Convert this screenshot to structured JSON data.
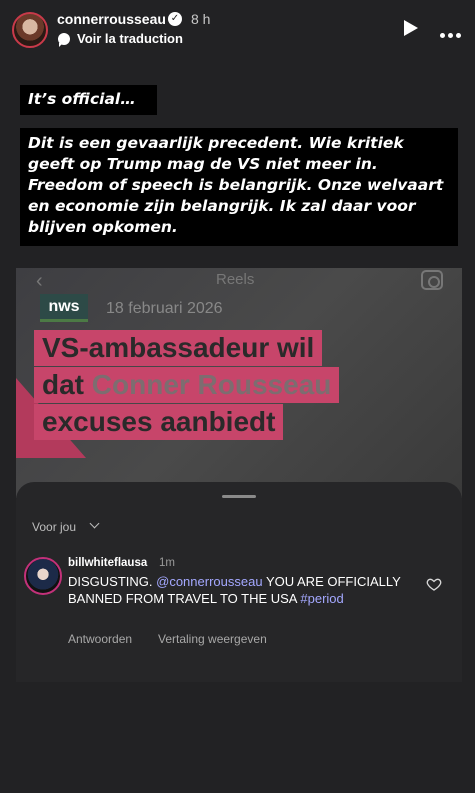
{
  "header": {
    "username": "connerrousseau",
    "time": "8 h",
    "translate_label": "Voir la traduction"
  },
  "captions": {
    "line1": "It’s official…",
    "line2": "Dit is een gevaarlijk precedent. Wie kritiek geeft op Trump mag de VS niet meer in. Freedom of speech is belangrijk. Onze welvaart en economie zijn belangrijk. Ik zal daar voor blijven opkomen."
  },
  "reel": {
    "title": "Reels",
    "logo": "nws",
    "date": "18 februari 2026",
    "headline_1": "VS-ambassadeur wil",
    "headline_2a": "dat ",
    "headline_2b": "Conner Rousseau",
    "headline_3": "excuses aanbiedt"
  },
  "comments": {
    "sort_label": "Voor jou",
    "items": [
      {
        "username": "billwhiteflausa",
        "time": "1m",
        "text_a": "DISGUSTING. ",
        "mention": "@connerrousseau",
        "text_b": " YOU ARE OFFICIALLY BANNED FROM TRAVEL TO THE USA ",
        "hashtag": "#period",
        "reply_label": "Antwoorden",
        "translate_label": "Vertaling weergeven"
      }
    ]
  },
  "colors": {
    "background": "#222224",
    "caption_bg": "#000000",
    "headline_pink": "#c7456a",
    "mention_blue": "#a4a8ff"
  }
}
